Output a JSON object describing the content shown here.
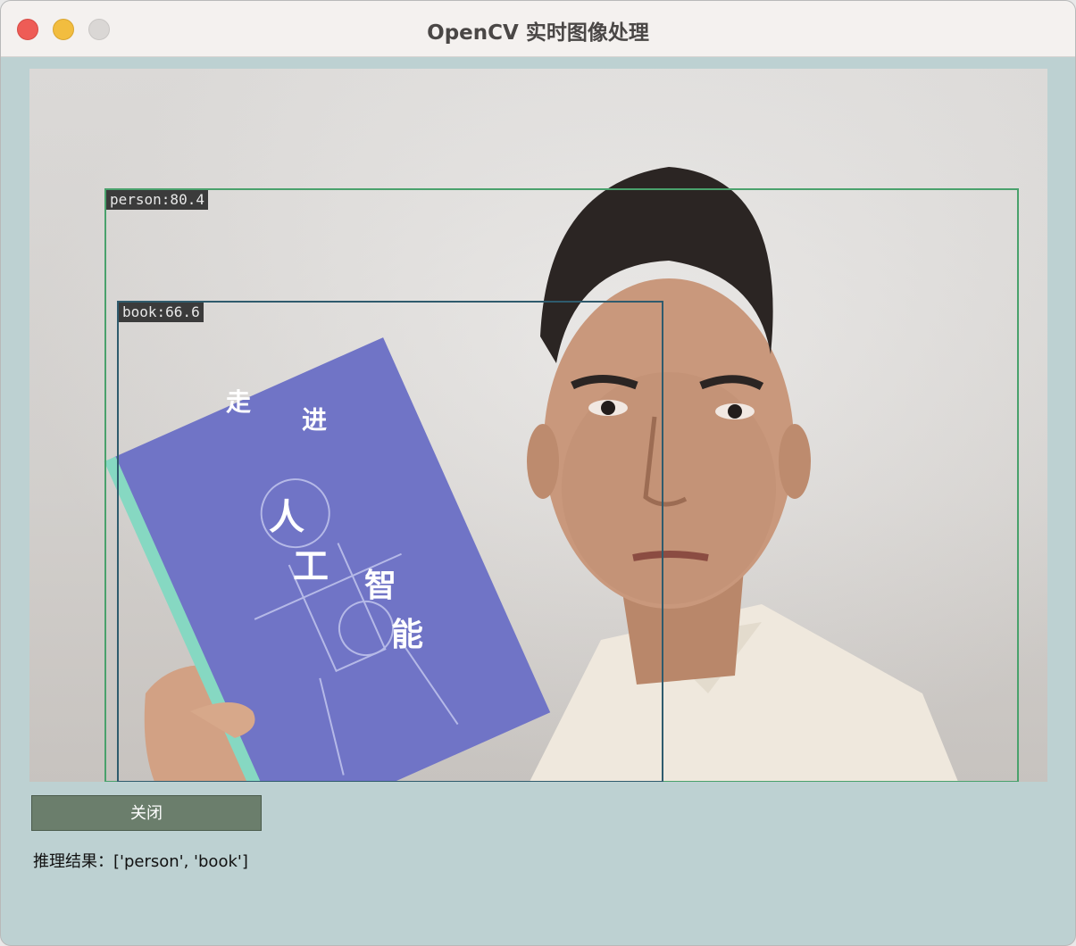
{
  "window": {
    "title": "OpenCV 实时图像处理"
  },
  "video": {
    "detections": [
      {
        "label": "person:80.4",
        "color": "#4aa16c"
      },
      {
        "label": "book:66.6",
        "color": "#2f5b6d"
      }
    ],
    "book_cover": {
      "chars": [
        "走",
        "进",
        "人",
        "工",
        "智",
        "能"
      ]
    }
  },
  "controls": {
    "close_label": "关闭"
  },
  "result": {
    "text": "推理结果：['person', 'book']"
  }
}
